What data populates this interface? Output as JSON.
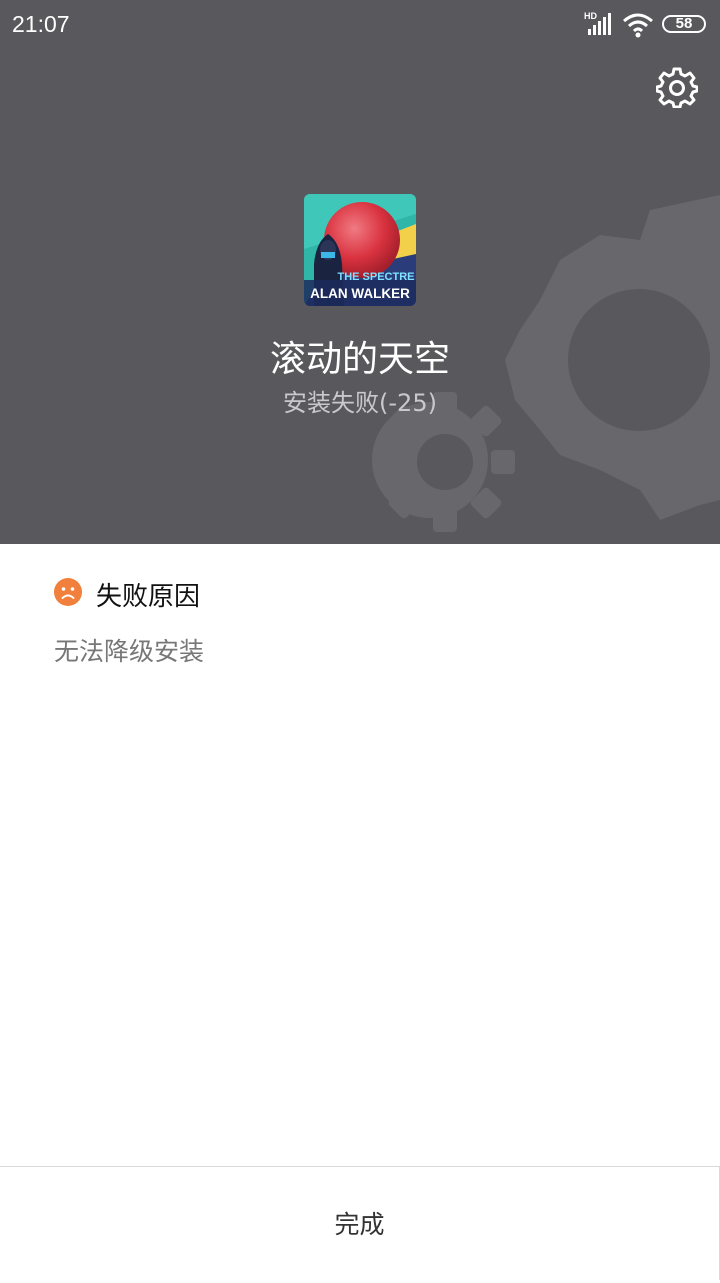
{
  "status_bar": {
    "time": "21:07",
    "network_label": "HD",
    "battery": "58"
  },
  "header": {
    "background": "#59585c",
    "settings_icon": "gear-icon"
  },
  "app": {
    "name": "滚动的天空",
    "status": "安装失败(-25)",
    "icon_text_top": "THE SPECTRE",
    "icon_text_bottom": "ALAN WALKER"
  },
  "failure": {
    "icon": "sad-face-icon",
    "icon_color": "#f0803c",
    "title": "失败原因",
    "detail": "无法降级安装"
  },
  "footer": {
    "done_label": "完成"
  }
}
